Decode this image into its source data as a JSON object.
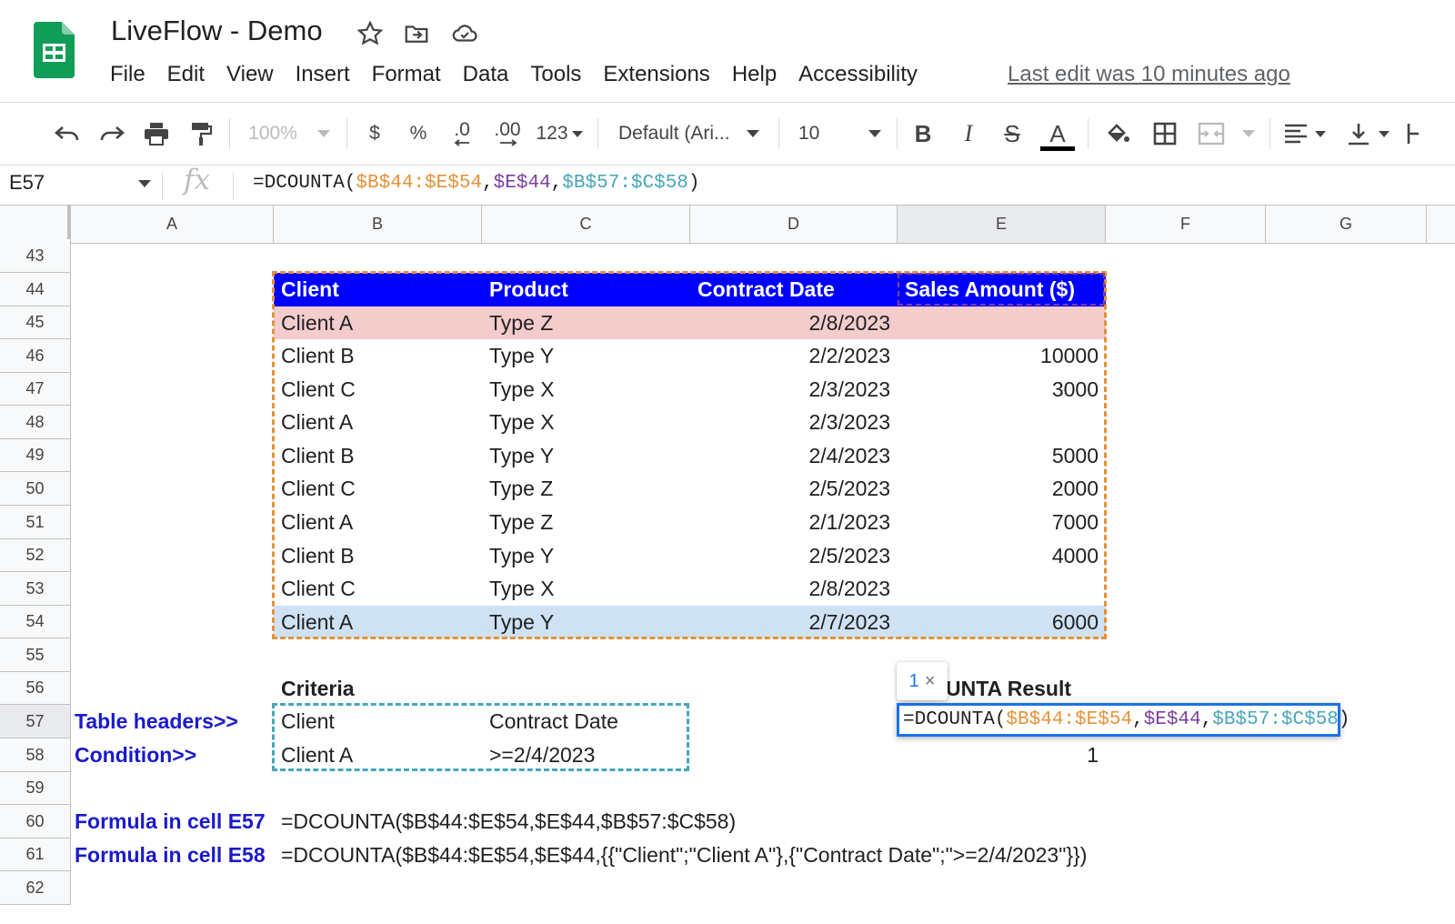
{
  "app": {
    "title": "LiveFlow - Demo",
    "last_edit": "Last edit was 10 minutes ago",
    "menu": [
      "File",
      "Edit",
      "View",
      "Insert",
      "Format",
      "Data",
      "Tools",
      "Extensions",
      "Help",
      "Accessibility"
    ]
  },
  "toolbar": {
    "zoom": "100%",
    "currency": "$",
    "percent": "%",
    "dec_decrease": ".0",
    "dec_increase": ".00",
    "more_formats": "123",
    "font": "Default (Ari...",
    "font_size": "10",
    "bold": "B",
    "italic": "I",
    "strike": "S",
    "text_color": "A"
  },
  "formula_bar": {
    "cell_ref": "E57",
    "fx": "fx",
    "f_prefix": "=DCOUNTA(",
    "f_arg1": "$B$44:$E$54",
    "f_comma1": ",",
    "f_arg2": "$E$44",
    "f_comma2": ",",
    "f_arg3": "$B$57:$C$58",
    "f_suffix": ")"
  },
  "columns": [
    "A",
    "B",
    "C",
    "D",
    "E",
    "F",
    "G"
  ],
  "rows": [
    "43",
    "44",
    "45",
    "46",
    "47",
    "48",
    "49",
    "50",
    "51",
    "52",
    "53",
    "54",
    "55",
    "56",
    "57",
    "58",
    "59",
    "60",
    "61",
    "62"
  ],
  "table": {
    "headers": [
      "Client",
      "Product",
      "Contract Date",
      "Sales Amount ($)"
    ],
    "rows": [
      [
        "Client A",
        "Type Z",
        "2/8/2023",
        ""
      ],
      [
        "Client B",
        "Type Y",
        "2/2/2023",
        "10000"
      ],
      [
        "Client C",
        "Type X",
        "2/3/2023",
        "3000"
      ],
      [
        "Client A",
        "Type X",
        "2/3/2023",
        ""
      ],
      [
        "Client B",
        "Type Y",
        "2/4/2023",
        "5000"
      ],
      [
        "Client C",
        "Type Z",
        "2/5/2023",
        "2000"
      ],
      [
        "Client A",
        "Type Z",
        "2/1/2023",
        "7000"
      ],
      [
        "Client B",
        "Type Y",
        "2/5/2023",
        "4000"
      ],
      [
        "Client C",
        "Type X",
        "2/8/2023",
        ""
      ],
      [
        "Client A",
        "Type Y",
        "2/7/2023",
        "6000"
      ]
    ]
  },
  "criteria": {
    "title": "Criteria",
    "label_headers": "Table headers>>",
    "label_condition": "Condition>>",
    "h1": "Client",
    "h2": "Contract Date",
    "v1": "Client A",
    "v2": ">=2/4/2023"
  },
  "result": {
    "title_visible": "UNTA Result",
    "edit_prefix": "=DCOUNTA(",
    "edit_arg1": "$B$44:$E$54",
    "edit_comma1": ",",
    "edit_arg2": "$E$44",
    "edit_comma2": ",",
    "edit_arg3": "$B$57:$C$58",
    "edit_suffix": ")",
    "value_e58": "1",
    "tooltip_num": "1",
    "tooltip_close": "×"
  },
  "notes": {
    "label_e57": "Formula in cell E57",
    "formula_e57": "=DCOUNTA($B$44:$E$54,$E$44,$B$57:$C$58)",
    "label_e58": "Formula in cell E58",
    "formula_e58": "=DCOUNTA($B$44:$E$54,$E$44,{{\"Client\";\"Client A\"},{\"Contract Date\";\">=2/4/2023\"}})"
  },
  "colors": {
    "header_fill": "#0000ff",
    "row_pink": "#f4cccc",
    "row_blue": "#cfe2f3",
    "range_orange": "#e69138",
    "range_purple": "#7b3f9e",
    "range_teal": "#46a6bd",
    "label_blue": "#1a1acc"
  }
}
